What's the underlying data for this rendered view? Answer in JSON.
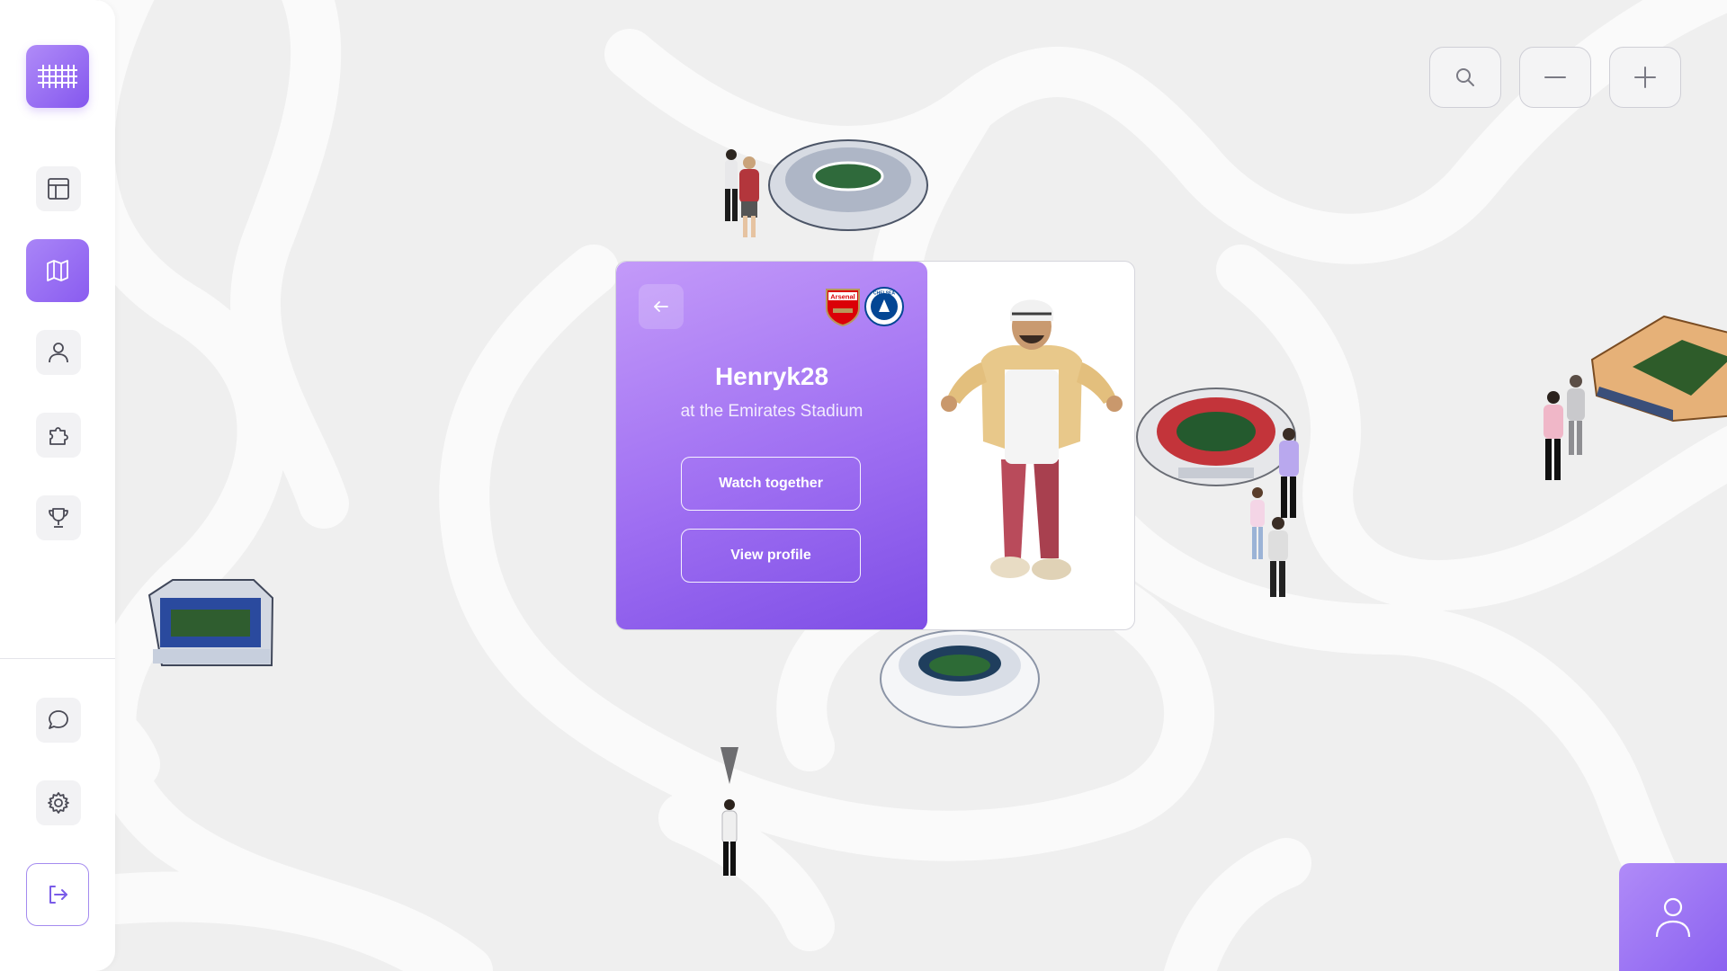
{
  "sidebar": {
    "logo_icon": "grid-logo-icon",
    "items": [
      {
        "name": "dashboard",
        "icon": "layout-icon",
        "active": false
      },
      {
        "name": "map",
        "icon": "map-icon",
        "active": true
      },
      {
        "name": "profile",
        "icon": "user-icon",
        "active": false
      },
      {
        "name": "extensions",
        "icon": "puzzle-icon",
        "active": false
      },
      {
        "name": "trophies",
        "icon": "trophy-icon",
        "active": false
      }
    ],
    "bottom_items": [
      {
        "name": "chat",
        "icon": "chat-icon"
      },
      {
        "name": "settings",
        "icon": "gear-icon"
      },
      {
        "name": "logout",
        "icon": "logout-icon"
      }
    ]
  },
  "map_controls": [
    {
      "name": "search",
      "icon": "search-icon"
    },
    {
      "name": "zoom-out",
      "icon": "minus-icon"
    },
    {
      "name": "zoom-in",
      "icon": "plus-icon"
    }
  ],
  "popup": {
    "username": "Henryk28",
    "location": "at the Emirates Stadium",
    "buttons": {
      "watch": "Watch together",
      "profile": "View profile"
    },
    "badges": [
      {
        "team": "Arsenal",
        "label": "Arsenal",
        "color": "#db0007"
      },
      {
        "team": "Chelsea",
        "label": "CHELSEA",
        "color": "#034694"
      }
    ]
  },
  "colors": {
    "accent": "#8a5cf0",
    "accent_light": "#b08bf8",
    "background": "#efefef",
    "path": "#fafafa"
  }
}
